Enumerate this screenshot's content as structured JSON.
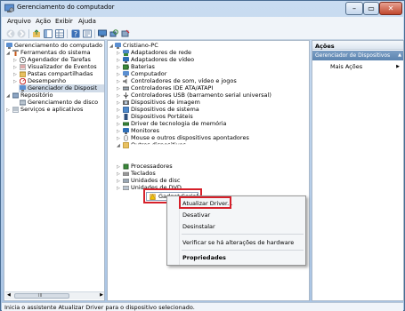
{
  "window": {
    "title": "Gerenciamento do computador",
    "min_glyph": "–",
    "max_glyph": "▭",
    "close_glyph": "✕"
  },
  "menubar": {
    "items": [
      "Arquivo",
      "Ação",
      "Exibir",
      "Ajuda"
    ]
  },
  "left_tree": {
    "root": "Gerenciamento do computado",
    "tools": "Ferramentas do sistema",
    "task_scheduler": "Agendador de Tarefas",
    "event_viewer": "Visualizador de Eventos",
    "shared_folders": "Pastas compartilhadas",
    "performance": "Desempenho",
    "device_manager": "Gerenciador de Disposit",
    "storage": "Repositório",
    "disk_mgmt": "Gerenciamento de disco",
    "services": "Serviços e aplicativos",
    "scroll_thumb": "III"
  },
  "device_tree": {
    "computer": "Cristiano-PC",
    "items": [
      "Adaptadores de rede",
      "Adaptadores de vídeo",
      "Baterias",
      "Computador",
      "Controladores de som, vídeo e jogos",
      "Controladores IDE ATA/ATAPI",
      "Controladores USB (barramento serial universal)",
      "Dispositivos de imagem",
      "Dispositivos de sistema",
      "Dispositivos Portáteis",
      "Driver de tecnologia de memória",
      "Monitores",
      "Mouse e outros dispositivos apontadores",
      "Outros dispositivos"
    ],
    "gadget": "Gadget Serial",
    "after_items": [
      "Processadores",
      "Teclados",
      "Unidades de disc",
      "Unidades de DVD"
    ]
  },
  "actions": {
    "header": "Ações",
    "section": "Gerenciador de Dispositivos",
    "more": "Mais Ações"
  },
  "context_menu": {
    "update": "Atualizar Driver...",
    "disable": "Desativar",
    "uninstall": "Desinstalar",
    "scan": "Verificar se há alterações de hardware",
    "properties": "Propriedades"
  },
  "statusbar": {
    "text": "Inicia o assistente Atualizar Driver para o dispositivo selecionado."
  },
  "colors": {
    "highlight": "#d6202a",
    "accent": "#5c84b0"
  }
}
